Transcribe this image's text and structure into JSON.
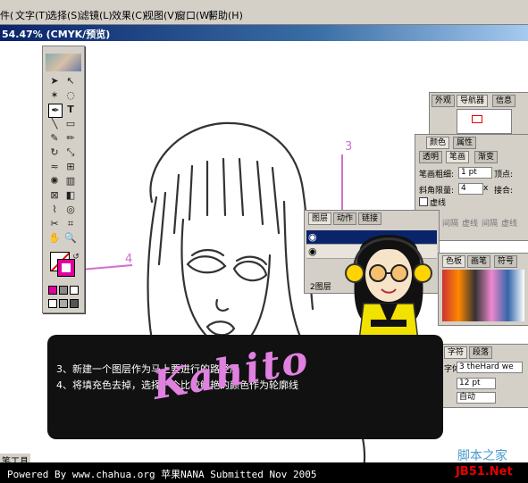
{
  "menu": {
    "file_partial": "件(",
    "items": [
      "文字(T)",
      "选择(S)",
      "滤镜(L)",
      "效果(C)",
      "视图(V)",
      "窗口(W)",
      "帮助(H)"
    ]
  },
  "document": {
    "title": "54.47% (CMYK/预览)"
  },
  "annotations": {
    "three": "3",
    "four": "4"
  },
  "navigator_panel": {
    "tabs": [
      "外观",
      "导航器",
      "信息"
    ]
  },
  "color_panel": {
    "tabs": [
      "颜色",
      "属性"
    ]
  },
  "stroke_panel": {
    "tabs": [
      "透明",
      "笔画",
      "渐变"
    ],
    "weight_label": "笔画粗细:",
    "weight_value": "1 pt",
    "cap_label": "顶点:",
    "miter_label": "斜角限量:",
    "miter_value": "4",
    "miter_unit": "x",
    "join_label": "接合:",
    "dashed_label": "虚线",
    "dash_labels": [
      "间隔",
      "虚线",
      "间隔",
      "虚线",
      "间隔"
    ]
  },
  "layers_panel": {
    "tabs": [
      "图层",
      "动作",
      "链接"
    ],
    "count_label": "2图层"
  },
  "swatches_panel": {
    "tabs": [
      "色板",
      "画笔",
      "符号"
    ]
  },
  "character_panel": {
    "tabs": [
      "字符",
      "段落"
    ],
    "font_label": "字体:",
    "font_value": "3 theHard we",
    "size_value": "12 pt",
    "leading_value": "自动"
  },
  "overlay": {
    "line1": "3、新建一个图层作为马上要进行的路径层",
    "line2": "4、将填充色去掉，选择一个比较鲜艳的颜色作为轮廓线",
    "signature": "Kahito"
  },
  "status": {
    "tool_label": "笔工具"
  },
  "footer": {
    "credit": "Powered By www.chahua.org 苹果NANA Submitted Nov 2005"
  },
  "watermark": {
    "site_cn": "脚本之家",
    "site_en": "JB51.Net"
  },
  "colors": {
    "menu_bg": "#d4d0c8",
    "title_blue": "#0a246a",
    "annotation_pink": "#d070d0",
    "signature_pink": "#e080e0"
  }
}
